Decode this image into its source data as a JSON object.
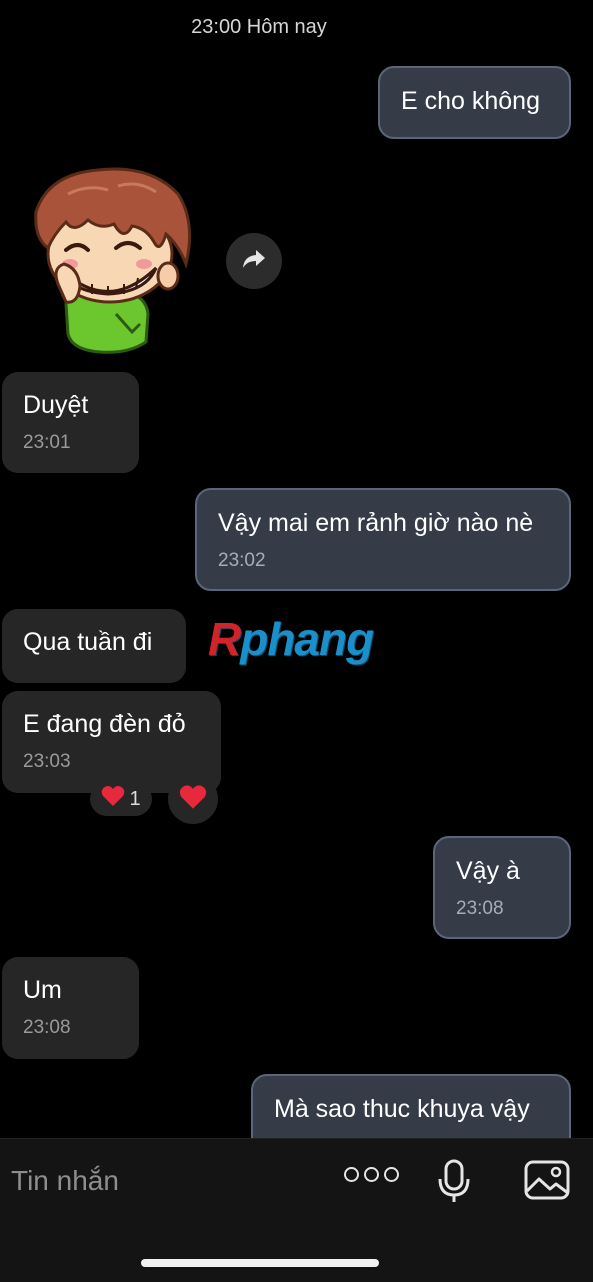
{
  "header": {
    "time_label": "23:00 Hôm nay"
  },
  "messages": [
    {
      "dir": "out",
      "text": "E cho không"
    },
    {
      "dir": "in",
      "type": "sticker",
      "sticker": "grinning-boy-sticker"
    },
    {
      "dir": "in",
      "text": "Duyệt",
      "time": "23:01"
    },
    {
      "dir": "out",
      "text": "Vậy mai em rảnh giờ nào nè",
      "time": "23:02"
    },
    {
      "dir": "in",
      "text": "Qua tuần đi"
    },
    {
      "dir": "in",
      "text": "E đang đèn đỏ",
      "time": "23:03",
      "reaction": {
        "emoji": "heart",
        "count": "1"
      }
    },
    {
      "dir": "out",
      "text": "Vậy à",
      "time": "23:08"
    },
    {
      "dir": "in",
      "text": "Um",
      "time": "23:08"
    },
    {
      "dir": "out",
      "text": "Mà sao thuc khuya vậy"
    }
  ],
  "watermark": {
    "first": "R",
    "rest": "phang"
  },
  "input": {
    "placeholder": "Tin nhắn"
  },
  "icons": {
    "forward": "forward-icon",
    "heart": "heart-icon",
    "more": "more-icon",
    "mic": "microphone-icon",
    "image": "image-icon"
  },
  "colors": {
    "bg": "#000000",
    "incoming_bubble": "#262626",
    "outgoing_bubble": "#353c48",
    "outgoing_border": "#5a6678",
    "heart": "#e8283c"
  }
}
